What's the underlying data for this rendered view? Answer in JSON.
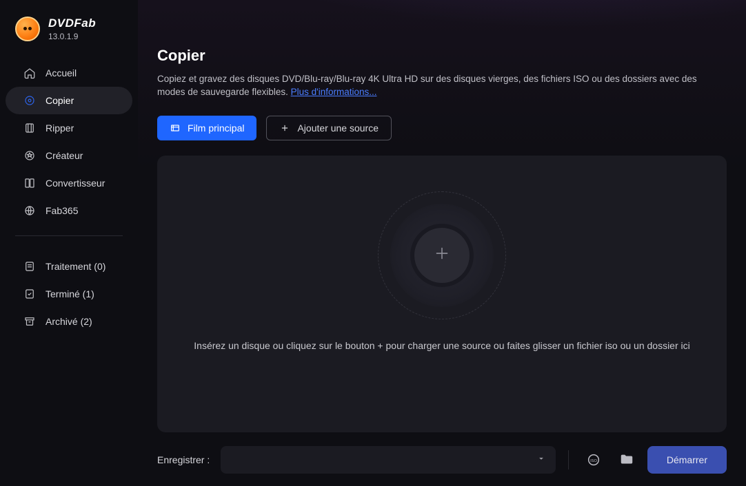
{
  "brand": {
    "name": "DVDFab",
    "version": "13.0.1.9"
  },
  "sidebar": {
    "items": [
      {
        "id": "home",
        "label": "Accueil",
        "icon": "home-icon",
        "active": false
      },
      {
        "id": "copy",
        "label": "Copier",
        "icon": "disc-icon",
        "active": true
      },
      {
        "id": "ripper",
        "label": "Ripper",
        "icon": "cut-icon",
        "active": false
      },
      {
        "id": "creator",
        "label": "Créateur",
        "icon": "star-icon",
        "active": false
      },
      {
        "id": "convert",
        "label": "Convertisseur",
        "icon": "convert-icon",
        "active": false
      },
      {
        "id": "fab365",
        "label": "Fab365",
        "icon": "globe-icon",
        "active": false
      }
    ],
    "below": [
      {
        "id": "processing",
        "label": "Traitement (0)",
        "icon": "task-icon"
      },
      {
        "id": "finished",
        "label": "Terminé (1)",
        "icon": "check-icon"
      },
      {
        "id": "archived",
        "label": "Archivé (2)",
        "icon": "archive-icon"
      }
    ]
  },
  "page": {
    "title": "Copier",
    "description": "Copiez et gravez des disques DVD/Blu-ray/Blu-ray 4K Ultra HD sur des disques vierges, des fichiers ISO ou des dossiers avec des modes de sauvegarde flexibles. ",
    "more_link": "Plus d'informations..."
  },
  "actions": {
    "primary_label": "Film principal",
    "add_source_label": "Ajouter une source"
  },
  "dropzone": {
    "hint": "Insérez un disque ou cliquez sur le bouton +  pour charger une source ou faites glisser un fichier iso ou un dossier ici"
  },
  "footer": {
    "save_label": "Enregistrer :",
    "save_value": "",
    "start_label": "Démarrer"
  }
}
